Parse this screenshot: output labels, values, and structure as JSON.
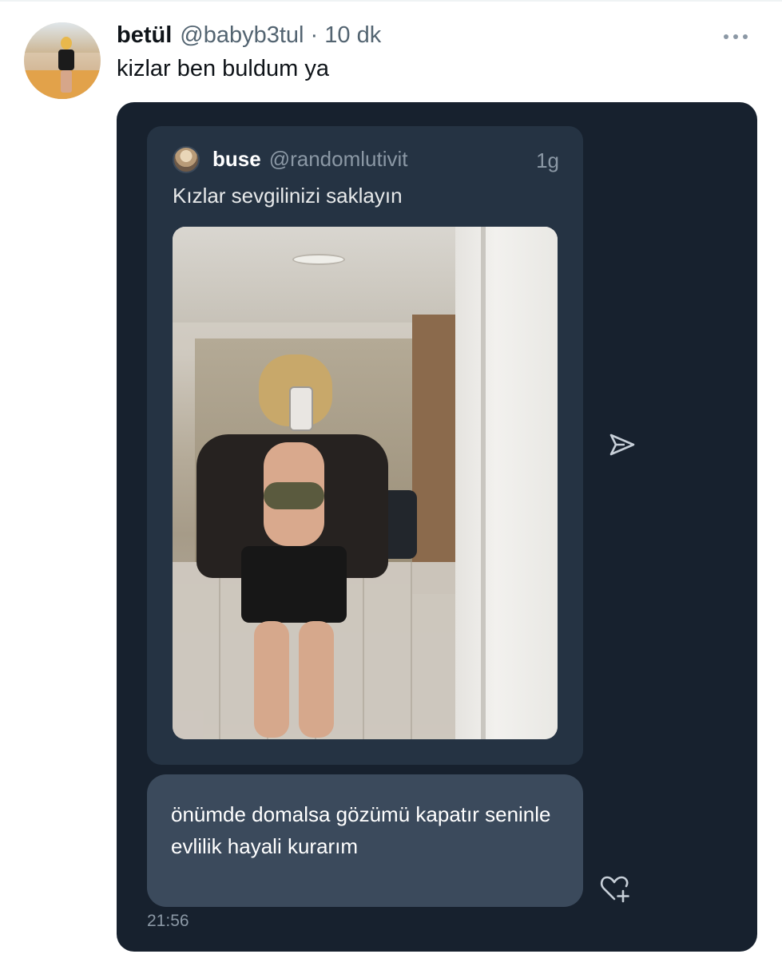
{
  "tweet": {
    "author_name": "betül",
    "author_meta": "@babyb3tul · 10 dk",
    "text": "kizlar ben buldum ya"
  },
  "dm_screenshot": {
    "quoted_tweet": {
      "name": "buse",
      "handle": "@randomlutivit",
      "time": "1g",
      "text": "Kızlar sevgilinizi saklayın"
    },
    "message": {
      "text": "önümde domalsa gözümü kapatır seninle evlilik hayali kurarım",
      "time": "21:56"
    }
  },
  "colors": {
    "dm_background": "#17212e",
    "quote_card": "#253343",
    "message_bubble": "#3b4a5c",
    "muted_text": "#8b98a5"
  },
  "icons": [
    "more-icon",
    "share-icon",
    "react-heart-plus-icon"
  ]
}
